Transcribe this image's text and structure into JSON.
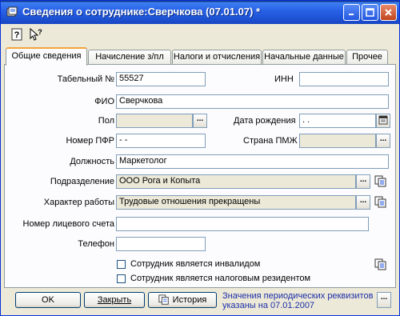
{
  "window": {
    "title": "Сведения о сотруднике:Сверчкова (07.01.07) *"
  },
  "tabs": [
    {
      "label": "Общие сведения"
    },
    {
      "label": "Начисление з/пл"
    },
    {
      "label": "Налоги и отчисления"
    },
    {
      "label": "Начальные данные"
    },
    {
      "label": "Прочее"
    }
  ],
  "form": {
    "tabnum_label": "Табельный №",
    "tabnum_value": "55527",
    "inn_label": "ИНН",
    "inn_value": "",
    "fio_label": "ФИО",
    "fio_value": "Сверчкова",
    "pol_label": "Пол",
    "pol_value": "",
    "birth_label": "Дата рождения",
    "birth_value": " .  .",
    "pfr_label": "Номер ПФР",
    "pfr_value": "  -   -",
    "country_label": "Страна ПМЖ",
    "country_value": "",
    "position_label": "Должность",
    "position_value": "Маркетолог",
    "dept_label": "Подразделение",
    "dept_value": "ООО Рога и Копыта",
    "work_label": "Характер работы",
    "work_value": "Трудовые отношения прекращены",
    "account_label": "Номер лицевого счета",
    "account_value": "",
    "phone_label": "Телефон",
    "phone_value": "",
    "invalid_label": "Сотрудник является инвалидом",
    "resident_label": "Сотрудник является налоговым резидентом",
    "dots": "..."
  },
  "footer": {
    "ok_label": "OK",
    "close_label": "Закрыть",
    "history_label": "История",
    "note_line1": "Значения периодических реквизитов",
    "note_line2": "указаны на 07.01.2007"
  }
}
